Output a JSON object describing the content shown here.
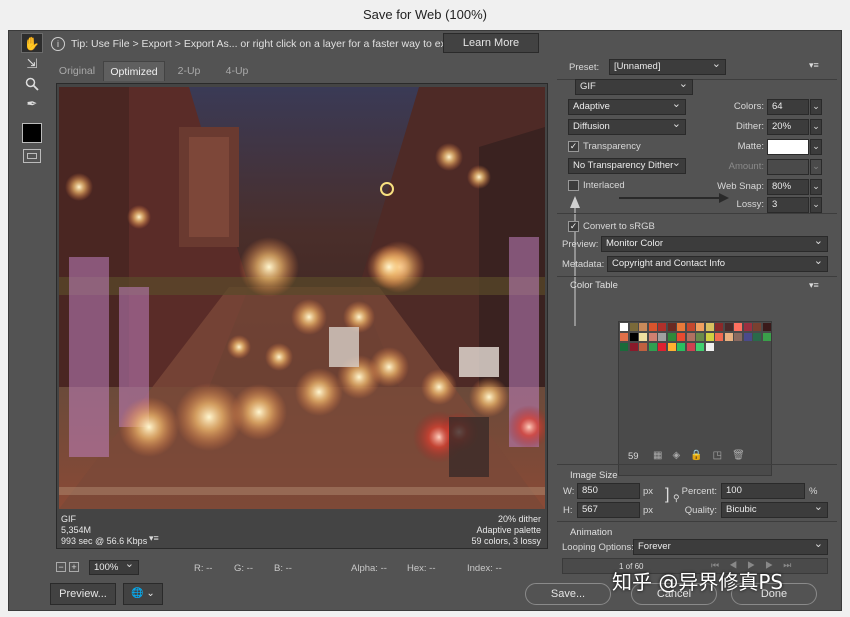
{
  "window": {
    "title": "Save for Web (100%)"
  },
  "tools": [
    {
      "name": "hand-tool-icon",
      "glyph": "✋"
    },
    {
      "name": "slice-select-tool-icon",
      "glyph": "⇲"
    },
    {
      "name": "zoom-tool-icon",
      "glyph": "🔍"
    },
    {
      "name": "eyedropper-tool-icon",
      "glyph": "✒"
    }
  ],
  "tip": {
    "text": "Tip: Use File > Export > Export As... or right click on a layer for a faster way to export assets",
    "button": "Learn More"
  },
  "tabs": [
    "Original",
    "Optimized",
    "2-Up",
    "4-Up"
  ],
  "active_tab": "Optimized",
  "preview_info": {
    "left": [
      "GIF",
      "5,354M",
      "993 sec @ 56.6 Kbps"
    ],
    "right": [
      "20% dither",
      "Adaptive palette",
      "59 colors, 3 lossy"
    ]
  },
  "bottom_bar": {
    "zoom": "100%",
    "readouts": [
      "R: --",
      "G: --",
      "B: --",
      "Alpha: --",
      "Hex: --",
      "Index: --"
    ]
  },
  "buttons": {
    "preview": "Preview...",
    "save": "Save...",
    "cancel": "Cancel",
    "done": "Done"
  },
  "settings": {
    "preset_label": "Preset:",
    "preset_value": "[Unnamed]",
    "format": "GIF",
    "reduction": "Adaptive",
    "dither_algorithm": "Diffusion",
    "transparency_label": "Transparency",
    "transparency_checked": true,
    "transparency_dither": "No Transparency Dither",
    "interlaced_label": "Interlaced",
    "interlaced_checked": false,
    "colors_label": "Colors:",
    "colors_value": "64",
    "dither_label": "Dither:",
    "dither_value": "20%",
    "matte_label": "Matte:",
    "amount_label": "Amount:",
    "web_snap_label": "Web Snap:",
    "web_snap_value": "80%",
    "lossy_label": "Lossy:",
    "lossy_value": "3",
    "convert_label": "Convert to sRGB",
    "convert_checked": true,
    "preview_label": "Preview:",
    "preview_value": "Monitor Color",
    "metadata_label": "Metadata:",
    "metadata_value": "Copyright and Contact Info"
  },
  "color_table": {
    "title": "Color Table",
    "count": "59",
    "colors": [
      "#ffffff",
      "#7a6a3a",
      "#c88a5a",
      "#d9542c",
      "#b0302a",
      "#6a2a22",
      "#e87a3a",
      "#c4482e",
      "#f0a060",
      "#d8c060",
      "#8a2a2a",
      "#4a2a2a",
      "#ff7060",
      "#9a3040",
      "#7a4030",
      "#3a1a1a",
      "#e0704a",
      "#000000",
      "#f0e0a0",
      "#d08070",
      "#a0a0a0",
      "#2e8a3a",
      "#e84a30",
      "#b07060",
      "#6a8a4a",
      "#d0d040",
      "#f06a50",
      "#e8b080",
      "#8a6a60",
      "#4a4a8a",
      "#2a6a4a",
      "#3aa04a",
      "#1a6a3a",
      "#8a1a2a",
      "#c06040",
      "#30a050",
      "#e02030",
      "#ffb030",
      "#28c060",
      "#d04050",
      "#40d070",
      "#f0f0f0"
    ]
  },
  "image_size": {
    "title": "Image Size",
    "w_label": "W:",
    "w_value": "850",
    "w_unit": "px",
    "h_label": "H:",
    "h_value": "567",
    "h_unit": "px",
    "percent_label": "Percent:",
    "percent_value": "100",
    "percent_unit": "%",
    "quality_label": "Quality:",
    "quality_value": "Bicubic"
  },
  "animation": {
    "title": "Animation",
    "looping_label": "Looping Options:",
    "looping_value": "Forever",
    "frame_counter": "1 of 60"
  },
  "watermark": "知乎 @异界修真PS"
}
